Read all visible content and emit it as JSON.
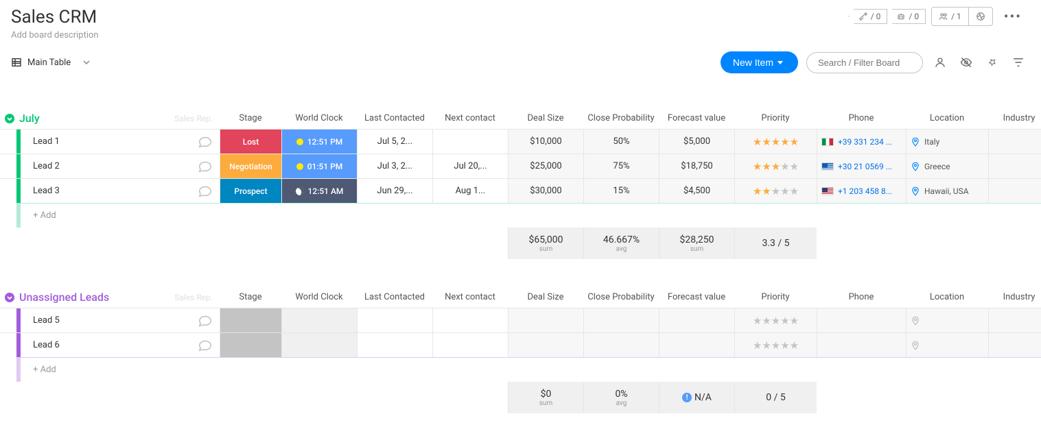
{
  "header": {
    "title": "Sales CRM",
    "subtitle": "Add board description",
    "badge1": "/ 0",
    "badge2": "/ 0",
    "badge3": "/ 1"
  },
  "toolbar": {
    "view_name": "Main Table",
    "new_item": "New Item",
    "search_placeholder": "Search / Filter Board"
  },
  "columns": [
    "Sales Rep.",
    "Stage",
    "World Clock",
    "Last Contacted",
    "Next contact",
    "Deal Size",
    "Close Probability",
    "Forecast value",
    "Priority",
    "Phone",
    "Location",
    "Industry"
  ],
  "groups": [
    {
      "key": "july",
      "title": "July",
      "rows": [
        {
          "name": "Lead 1",
          "stage": "Lost",
          "stage_class": "stage-lost",
          "clock": "12:51 PM",
          "clock_class": "clock-day",
          "last": "Jul 5, 2...",
          "next": "",
          "deal": "$10,000",
          "prob": "50%",
          "forecast": "$5,000",
          "stars": 5,
          "phone": "+39 331 234 ...",
          "flag": "flag-it",
          "loc": "Italy"
        },
        {
          "name": "Lead 2",
          "stage": "Negotiation",
          "stage_class": "stage-neg",
          "clock": "01:51 PM",
          "clock_class": "clock-day",
          "last": "Jul 3, 2...",
          "next": "Jul 20,...",
          "deal": "$25,000",
          "prob": "75%",
          "forecast": "$18,750",
          "stars": 3,
          "phone": "+30 21 0569 ...",
          "flag": "flag-gr",
          "loc": "Greece"
        },
        {
          "name": "Lead 3",
          "stage": "Prospect",
          "stage_class": "stage-pros",
          "clock": "12:51 AM",
          "clock_class": "clock-night",
          "last": "Jun 29,...",
          "next": "Aug 1...",
          "deal": "$30,000",
          "prob": "15%",
          "forecast": "$4,500",
          "stars": 2,
          "phone": "+1 203 458 8...",
          "flag": "flag-us",
          "loc": "Hawaii, USA"
        }
      ],
      "summary": {
        "deal": "$65,000",
        "deal_lbl": "sum",
        "prob": "46.667%",
        "prob_lbl": "avg",
        "forecast": "$28,250",
        "forecast_lbl": "sum",
        "priority": "3.3 / 5"
      }
    },
    {
      "key": "unassigned",
      "title": "Unassigned Leads",
      "rows": [
        {
          "name": "Lead 5",
          "stage": "",
          "stage_class": "stage-empty",
          "clock": "",
          "clock_class": "clock-empty",
          "last": "",
          "next": "",
          "deal": "",
          "prob": "",
          "forecast": "",
          "stars": 0,
          "phone": "",
          "flag": "",
          "loc": ""
        },
        {
          "name": "Lead 6",
          "stage": "",
          "stage_class": "stage-empty",
          "clock": "",
          "clock_class": "clock-empty",
          "last": "",
          "next": "",
          "deal": "",
          "prob": "",
          "forecast": "",
          "stars": 0,
          "phone": "",
          "flag": "",
          "loc": ""
        }
      ],
      "summary": {
        "deal": "$0",
        "deal_lbl": "sum",
        "prob": "0%",
        "prob_lbl": "avg",
        "forecast": "N/A",
        "forecast_lbl": "",
        "priority": "0 / 5",
        "forecast_na": true
      }
    }
  ],
  "add_label": "+ Add"
}
